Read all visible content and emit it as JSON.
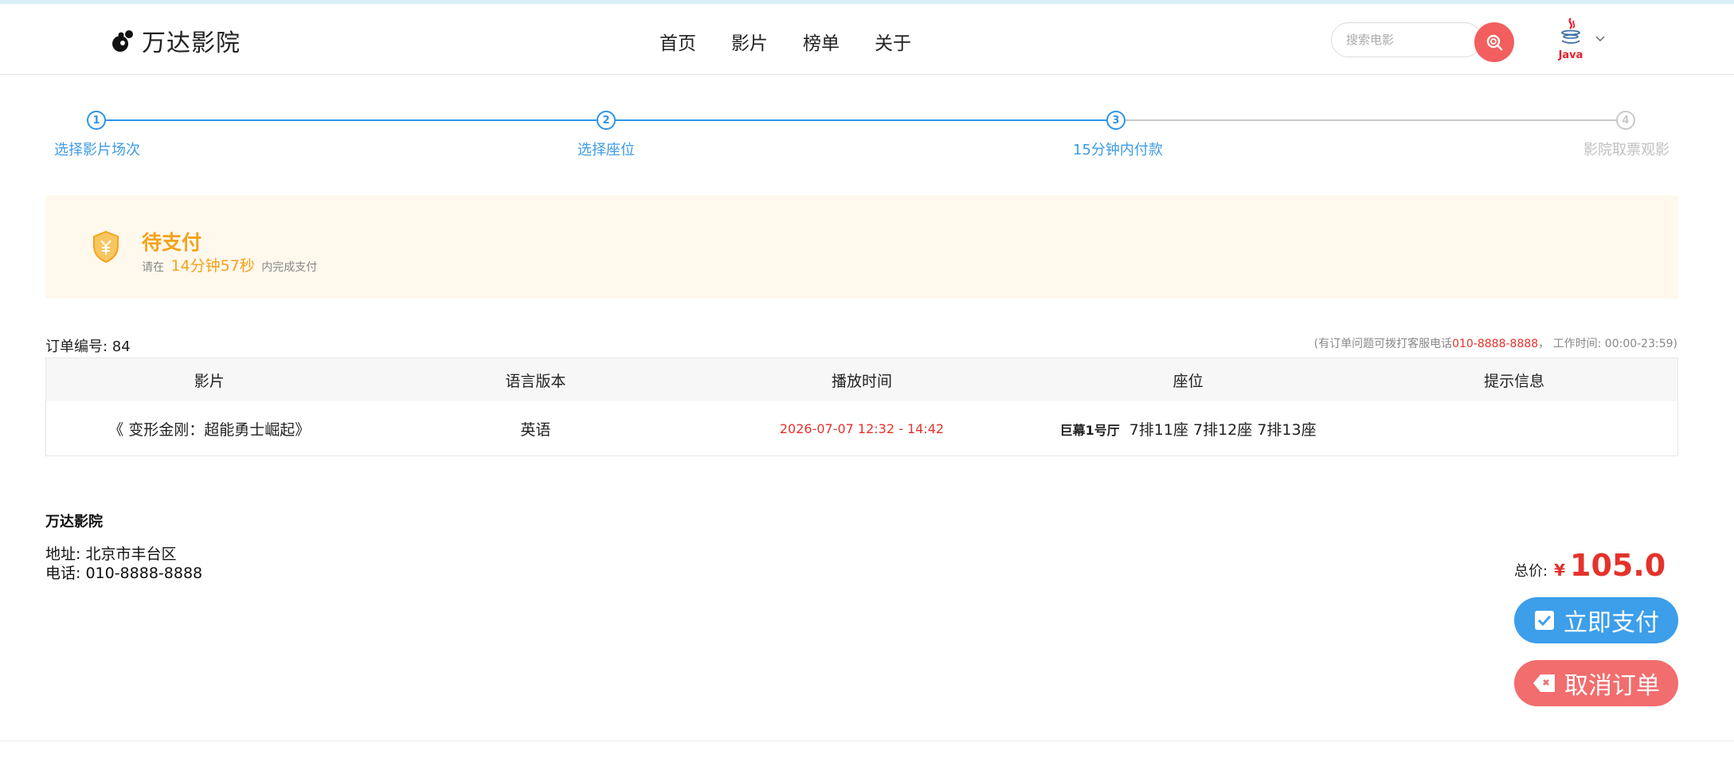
{
  "header": {
    "logo_text": "万达影院",
    "nav": [
      "首页",
      "影片",
      "榜单",
      "关于"
    ],
    "search_placeholder": "搜索电影",
    "user_avatar_label": "Java"
  },
  "steps": [
    {
      "num": "1",
      "label": "选择影片场次",
      "active": true
    },
    {
      "num": "2",
      "label": "选择座位",
      "active": true
    },
    {
      "num": "3",
      "label": "15分钟内付款",
      "active": true
    },
    {
      "num": "4",
      "label": "影院取票观影",
      "active": false
    }
  ],
  "pending": {
    "title": "待支付",
    "prefix": "请在",
    "time": "14分钟57秒",
    "suffix": "内完成支付"
  },
  "order": {
    "number_label": "订单编号: 84",
    "hint_prefix": "(有订单问题可拨打客服电话",
    "hint_phone": "010-8888-8888",
    "hint_suffix": "， 工作时间: 00:00-23:59)",
    "columns": [
      "影片",
      "语言版本",
      "播放时间",
      "座位",
      "提示信息"
    ],
    "row": {
      "movie": "《 变形金刚：超能勇士崛起》",
      "language": "英语",
      "time": "2026-07-07 12:32 - 14:42",
      "hall": "巨幕1号厅",
      "seats": "7排11座 7排12座 7排13座",
      "tip": ""
    }
  },
  "cinema": {
    "name": "万达影院",
    "address": "地址: 北京市丰台区",
    "phone": "电话: 010-8888-8888"
  },
  "payment": {
    "total_label": "总价:",
    "currency": "¥",
    "total": "105.0",
    "pay_label": "立即支付",
    "cancel_label": "取消订单"
  },
  "colors": {
    "primary": "#3d9eea",
    "danger": "#f26d6d",
    "price": "#e4322b",
    "pending": "#f2a31c"
  }
}
